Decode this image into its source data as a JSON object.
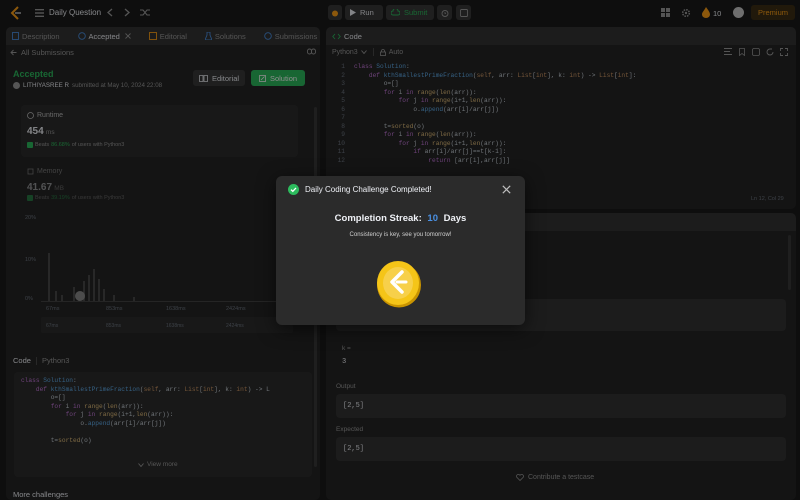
{
  "topbar": {
    "problem_list_label": "Daily Question",
    "run_label": "Run",
    "submit_label": "Submit",
    "streak_count": "10",
    "premium_label": "Premium"
  },
  "left_tabs": {
    "description": "Description",
    "accepted": "Accepted",
    "editorial": "Editorial",
    "solutions": "Solutions",
    "submissions": "Submissions"
  },
  "submission": {
    "back_label": "All Submissions",
    "status": "Accepted",
    "user": "LITHIYASREE R",
    "submitted_at": "submitted at May 10, 2024 22:08",
    "editorial_button": "Editorial",
    "solution_button": "Solution",
    "runtime_label": "Runtime",
    "runtime_value": "454",
    "runtime_unit": "ms",
    "runtime_beats_prefix": "Beats",
    "runtime_beats_pct": "86.68%",
    "runtime_beats_suffix": "of users with Python3",
    "memory_label": "Memory",
    "memory_value": "41.67",
    "memory_unit": "MB",
    "memory_beats_prefix": "Beats",
    "memory_beats_pct": "39.19%",
    "memory_beats_suffix": "of users with Python3",
    "chart_ticks_y": [
      "20%",
      "10%",
      "0%"
    ],
    "chart_ticks_x": [
      "67ms",
      "853ms",
      "1638ms",
      "2424ms"
    ],
    "code_label": "Code",
    "code_lang": "Python3",
    "view_more": "View more",
    "more_challenges": "More challenges"
  },
  "left_code_lines": [
    "class Solution:",
    "    def kthSmallestPrimeFraction(self, arr: List[int], k: int) -> L",
    "        o=[]",
    "        for i in range(len(arr)):",
    "            for j in range(i+1,len(arr)):",
    "                o.append(arr[i]/arr[j])",
    "",
    "        t=sorted(o)"
  ],
  "editor": {
    "title": "Code",
    "lang": "Python3",
    "auto_label": "Auto",
    "cursor_pos": "Ln 12, Col 29",
    "lines": [
      "class Solution:",
      "    def kthSmallestPrimeFraction(self, arr: List[int], k: int) -> List[int]:",
      "        o=[]",
      "        for i in range(len(arr)):",
      "            for j in range(i+1,len(arr)):",
      "                o.append(arr[i]/arr[j])",
      "",
      "        t=sorted(o)",
      "        for i in range(len(arr)):",
      "            for j in range(i+1,len(arr)):",
      "                if arr[i]/arr[j]==t[k-1]:",
      "                    return [arr[i],arr[j]]"
    ],
    "line_numbers": [
      "1",
      "2",
      "3",
      "4",
      "5",
      "6",
      "7",
      "8",
      "9",
      "10",
      "11",
      "12"
    ]
  },
  "testcase": {
    "k_label": "k =",
    "k_value": "3",
    "output_label": "Output",
    "output_value": "[2,5]",
    "expected_label": "Expected",
    "expected_value": "[2,5]",
    "contribute_label": "Contribute a testcase"
  },
  "modal": {
    "title": "Daily Coding Challenge Completed!",
    "streak_prefix": "Completion Streak:",
    "streak_value": "10",
    "streak_suffix": "Days",
    "message": "Consistency is key, see you tomorrow!"
  },
  "colors": {
    "accent_green": "#2cbb5d",
    "accent_blue": "#4a90e2",
    "coin_gold": "#f5c518"
  }
}
